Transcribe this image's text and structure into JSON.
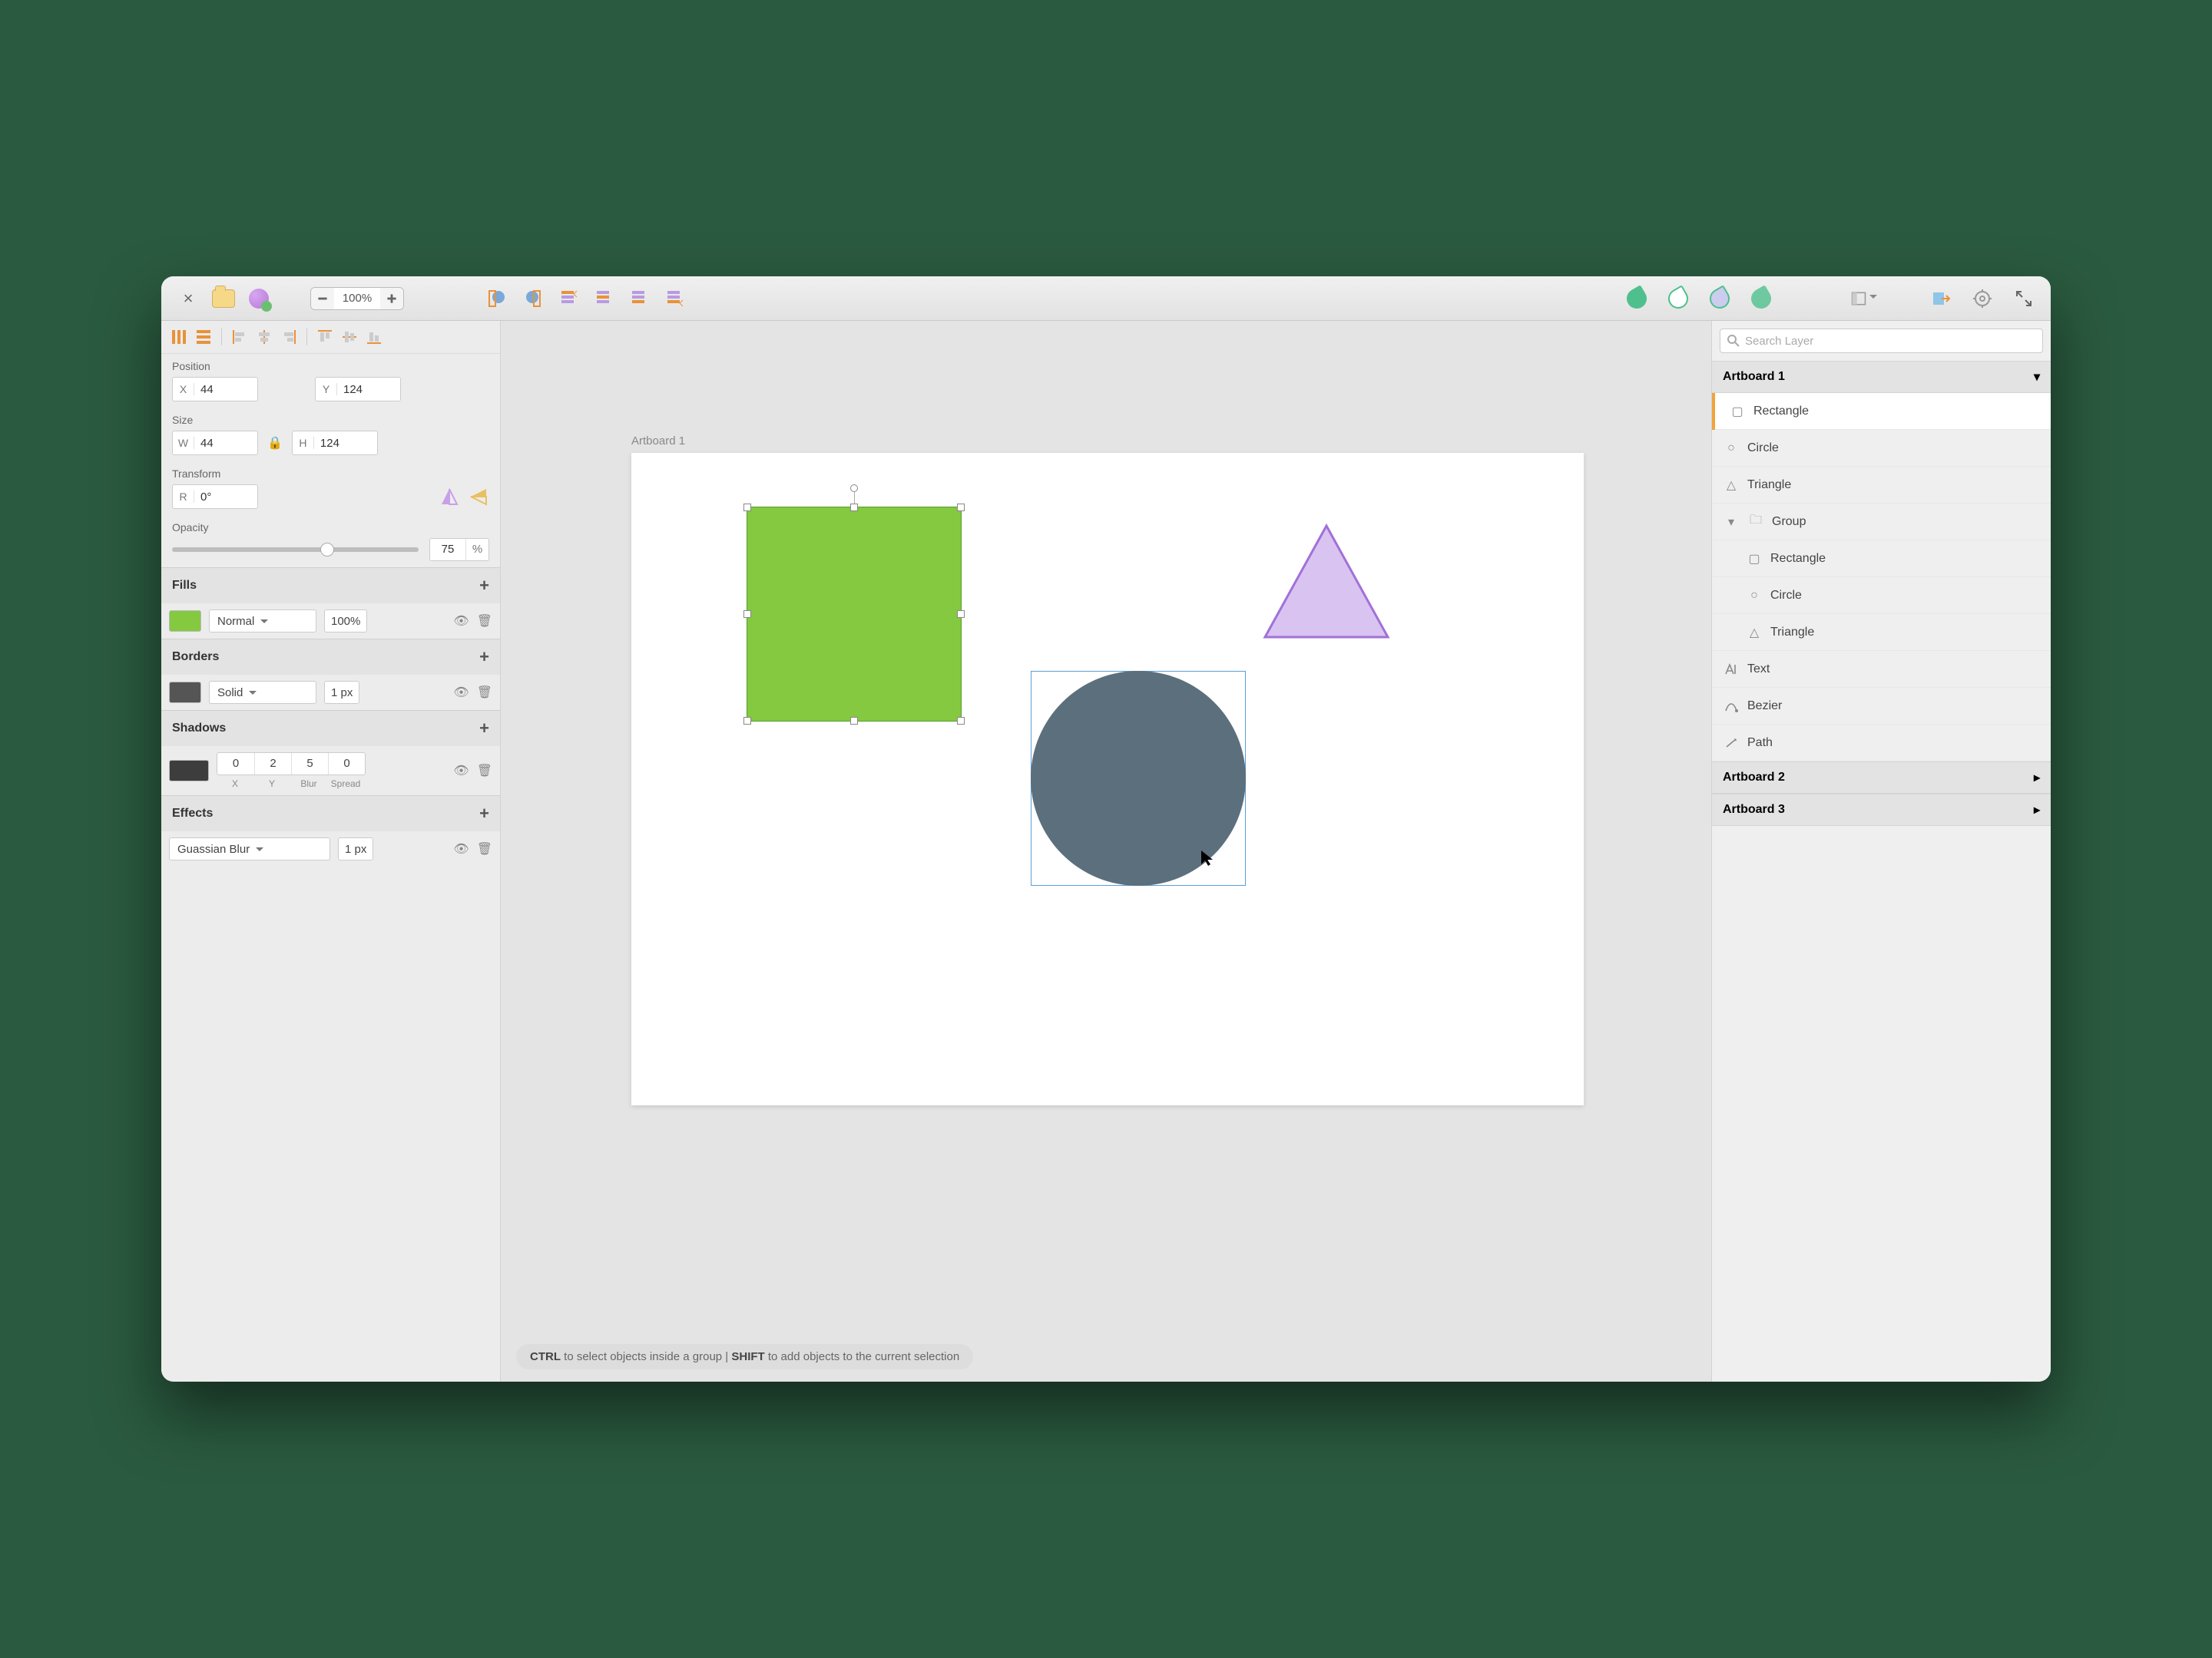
{
  "toolbar": {
    "zoom": "100%"
  },
  "left": {
    "position_label": "Position",
    "x_label": "X",
    "x_val": "44",
    "y_label": "Y",
    "y_val": "124",
    "size_label": "Size",
    "w_label": "W",
    "w_val": "44",
    "h_label": "H",
    "h_val": "124",
    "transform_label": "Transform",
    "r_label": "R",
    "r_val": "0°",
    "opacity_label": "Opacity",
    "opacity_val": "75",
    "opacity_unit": "%",
    "fills": {
      "title": "Fills",
      "mode": "Normal",
      "percent": "100%",
      "swatch": "#84c940"
    },
    "borders": {
      "title": "Borders",
      "mode": "Solid",
      "width": "1 px",
      "swatch": "#555555"
    },
    "shadows": {
      "title": "Shadows",
      "vals": [
        "0",
        "2",
        "5",
        "0"
      ],
      "labels": [
        "X",
        "Y",
        "Blur",
        "Spread"
      ],
      "swatch": "#3d3d3d"
    },
    "effects": {
      "title": "Effects",
      "mode": "Guassian Blur",
      "width": "1 px"
    }
  },
  "canvas": {
    "artboard_label": "Artboard 1"
  },
  "hint": {
    "k1": "CTRL",
    "t1": " to select objects inside a group | ",
    "k2": "SHIFT",
    "t2": " to add objects to the current selection"
  },
  "right": {
    "search_placeholder": "Search Layer",
    "artboards": [
      "Artboard 1",
      "Artboard 2",
      "Artboard 3"
    ],
    "layers": [
      "Rectangle",
      "Circle",
      "Triangle",
      "Group",
      "Rectangle",
      "Circle",
      "Triangle",
      "Text",
      "Bezier",
      "Path"
    ]
  }
}
